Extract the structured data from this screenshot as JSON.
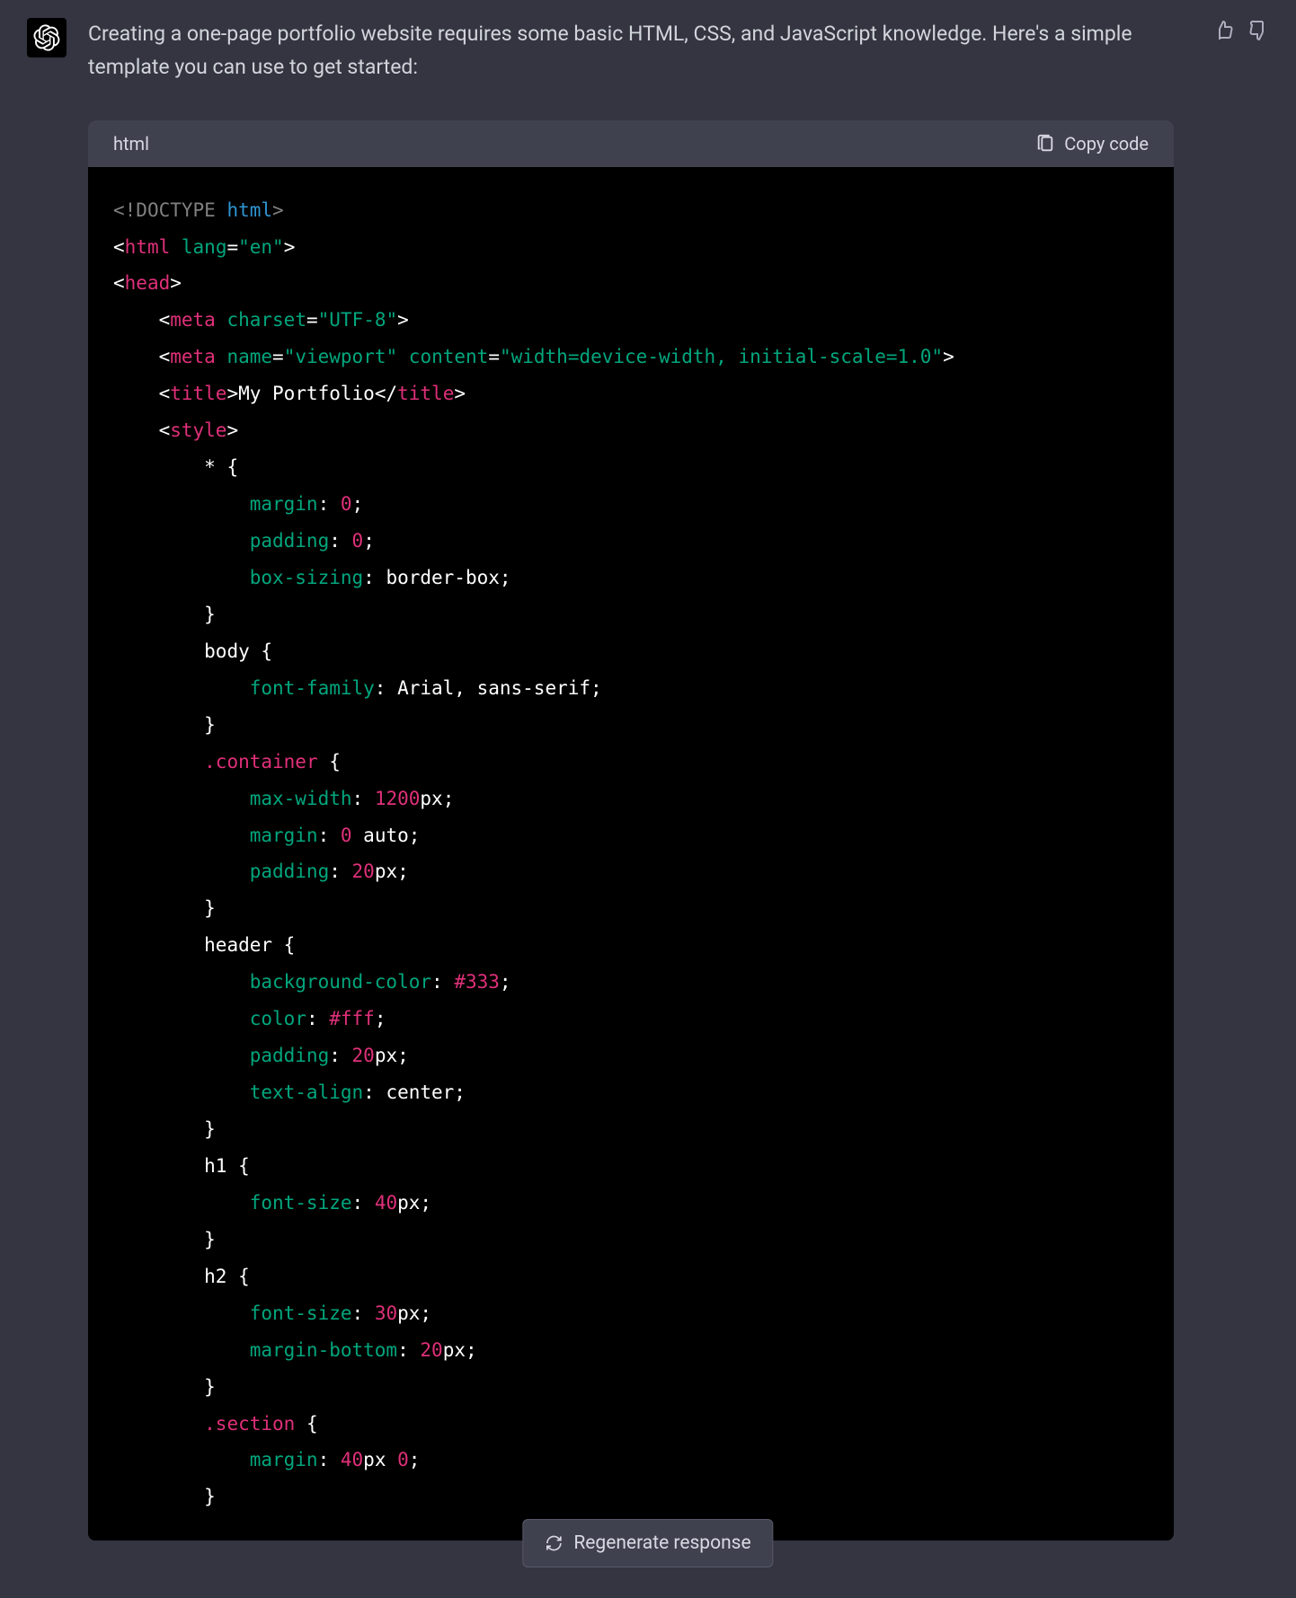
{
  "message": {
    "intro": "Creating a one-page portfolio website requires some basic HTML, CSS, and JavaScript knowledge. Here's a simple template you can use to get started:"
  },
  "code_block": {
    "language": "html",
    "copy_label": "Copy code"
  },
  "code": {
    "l1_a": "<!",
    "l1_b": "DOCTYPE",
    "l1_c": " ",
    "l1_d": "html",
    "l1_e": ">",
    "l2_a": "<",
    "l2_b": "html",
    "l2_c": " ",
    "l2_d": "lang",
    "l2_e": "=",
    "l2_f": "\"en\"",
    "l2_g": ">",
    "l3_a": "<",
    "l3_b": "head",
    "l3_c": ">",
    "l4_pad": "    ",
    "l4_a": "<",
    "l4_b": "meta",
    "l4_c": " ",
    "l4_d": "charset",
    "l4_e": "=",
    "l4_f": "\"UTF-8\"",
    "l4_g": ">",
    "l5_pad": "    ",
    "l5_a": "<",
    "l5_b": "meta",
    "l5_c": " ",
    "l5_d": "name",
    "l5_e": "=",
    "l5_f": "\"viewport\"",
    "l5_g": " ",
    "l5_h": "content",
    "l5_i": "=",
    "l5_j": "\"width=device-width, initial-scale=1.0\"",
    "l5_k": ">",
    "l6_pad": "    ",
    "l6_a": "<",
    "l6_b": "title",
    "l6_c": ">",
    "l6_d": "My Portfolio",
    "l6_e": "</",
    "l6_f": "title",
    "l6_g": ">",
    "l7_pad": "    ",
    "l7_a": "<",
    "l7_b": "style",
    "l7_c": ">",
    "l8_pad": "        ",
    "l8_a": "* {",
    "l9_pad": "            ",
    "l9_a": "margin",
    "l9_b": ": ",
    "l9_c": "0",
    "l9_d": ";",
    "l10_pad": "            ",
    "l10_a": "padding",
    "l10_b": ": ",
    "l10_c": "0",
    "l10_d": ";",
    "l11_pad": "            ",
    "l11_a": "box-sizing",
    "l11_b": ": border-box;",
    "l12_pad": "        ",
    "l12_a": "}",
    "l13_pad": "        ",
    "l13_a": "body {",
    "l14_pad": "            ",
    "l14_a": "font-family",
    "l14_b": ": Arial, sans-serif;",
    "l15_pad": "        ",
    "l15_a": "}",
    "l16_pad": "        ",
    "l16_a": ".container",
    "l16_b": " {",
    "l17_pad": "            ",
    "l17_a": "max-width",
    "l17_b": ": ",
    "l17_c": "1200",
    "l17_d": "px",
    "l17_e": ";",
    "l18_pad": "            ",
    "l18_a": "margin",
    "l18_b": ": ",
    "l18_c": "0",
    "l18_d": " auto;",
    "l19_pad": "            ",
    "l19_a": "padding",
    "l19_b": ": ",
    "l19_c": "20",
    "l19_d": "px",
    "l19_e": ";",
    "l20_pad": "        ",
    "l20_a": "}",
    "l21_pad": "        ",
    "l21_a": "header {",
    "l22_pad": "            ",
    "l22_a": "background-color",
    "l22_b": ": ",
    "l22_c": "#333",
    "l22_d": ";",
    "l23_pad": "            ",
    "l23_a": "color",
    "l23_b": ": ",
    "l23_c": "#fff",
    "l23_d": ";",
    "l24_pad": "            ",
    "l24_a": "padding",
    "l24_b": ": ",
    "l24_c": "20",
    "l24_d": "px",
    "l24_e": ";",
    "l25_pad": "            ",
    "l25_a": "text-align",
    "l25_b": ": center;",
    "l26_pad": "        ",
    "l26_a": "}",
    "l27_pad": "        ",
    "l27_a": "h1 {",
    "l28_pad": "            ",
    "l28_a": "font-size",
    "l28_b": ": ",
    "l28_c": "40",
    "l28_d": "px",
    "l28_e": ";",
    "l29_pad": "        ",
    "l29_a": "}",
    "l30_pad": "        ",
    "l30_a": "h2 {",
    "l31_pad": "            ",
    "l31_a": "font-size",
    "l31_b": ": ",
    "l31_c": "30",
    "l31_d": "px",
    "l31_e": ";",
    "l32_pad": "            ",
    "l32_a": "margin-bottom",
    "l32_b": ": ",
    "l32_c": "20",
    "l32_d": "px",
    "l32_e": ";",
    "l33_pad": "        ",
    "l33_a": "}",
    "l34_pad": "        ",
    "l34_a": ".section",
    "l34_b": " {",
    "l35_pad": "            ",
    "l35_a": "margin",
    "l35_b": ": ",
    "l35_c": "40",
    "l35_d": "px",
    "l35_e": " ",
    "l35_f": "0",
    "l35_g": ";",
    "l36_pad": "        ",
    "l36_a": "}"
  },
  "regenerate": {
    "label": "Regenerate response"
  }
}
